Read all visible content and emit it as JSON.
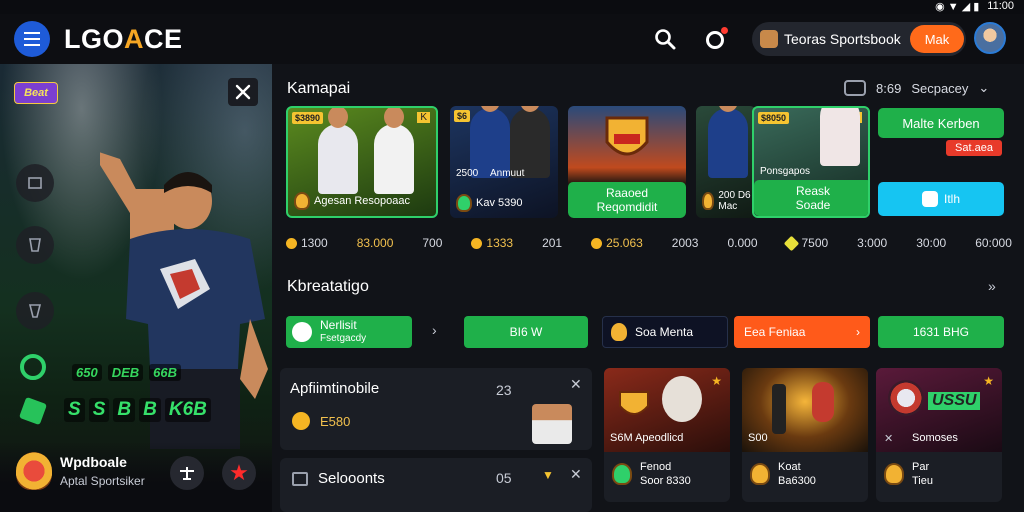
{
  "status": {
    "time": "11:00"
  },
  "header": {
    "logo_prefix": "LGO",
    "logo_mid": "A",
    "logo_suffix": "CE",
    "sportsbook_label": "Teoras Sportsbook",
    "sportsbook_button": "Mak"
  },
  "hero": {
    "badge": "Beat",
    "stats": [
      "650",
      "DEB",
      "66B"
    ],
    "odds": [
      "S",
      "S",
      "B",
      "B",
      "K6B"
    ],
    "footer_title": "Wpdboale",
    "footer_sub": "Aptal Sportsiker"
  },
  "featured": {
    "title": "Kamapai",
    "counter": "8:69",
    "sort_label": "Secpacey",
    "cards": [
      {
        "tag": "$3890",
        "caption": "Agesan Resopoaac"
      },
      {
        "tag": "$6",
        "caption1": "2500",
        "caption2": "Anmuut",
        "caption3": "Kav 5390"
      },
      {
        "tag": "",
        "button_line1": "Raaoed",
        "button_line2": "Reqomdidit"
      },
      {
        "tag": "",
        "caption": "200 D6 Mac"
      },
      {
        "tag": "$8050",
        "caption": "Ponsgapos",
        "button_line1": "Reask",
        "button_line2": "Soade"
      }
    ],
    "side_green": "Malte Kerben",
    "side_red": "Sat.aea",
    "side_cyan": "Itlh"
  },
  "odds_strip": [
    {
      "value": "1300",
      "icon": true
    },
    {
      "value": "83.000",
      "gold": true
    },
    {
      "value": "700"
    },
    {
      "value": "1333",
      "icon": true
    },
    {
      "value": "201"
    },
    {
      "value": "25.063",
      "icon": true
    },
    {
      "value": "2003"
    },
    {
      "value": "0.000"
    },
    {
      "value": "7500",
      "icon": true
    },
    {
      "value": "3:000"
    },
    {
      "value": "30:00"
    },
    {
      "value": "60:000"
    }
  ],
  "quick": {
    "title": "Kbreatatigo",
    "item1_line1": "Nerlisit",
    "item1_line2": "Fsetgacdy",
    "item2": "BI6 W",
    "item3": "Soa Menta",
    "item4": "Eea Feniaa",
    "item5": "1631 BHG"
  },
  "panels": {
    "p1_title": "Apfiimtinobile",
    "p1_num": "23",
    "p1_value": "E580",
    "p2_title": "Selooonts",
    "p2_num": "05"
  },
  "games": [
    {
      "caption": "S6M Apeodlicd",
      "line1": "Fenod",
      "line2": "Soor 8330"
    },
    {
      "caption": "S00",
      "line1": "Koat",
      "line2": "Ba6300"
    },
    {
      "caption": "Somoses",
      "line1": "Par",
      "line2": "Tieu",
      "banner": "USSU"
    }
  ]
}
